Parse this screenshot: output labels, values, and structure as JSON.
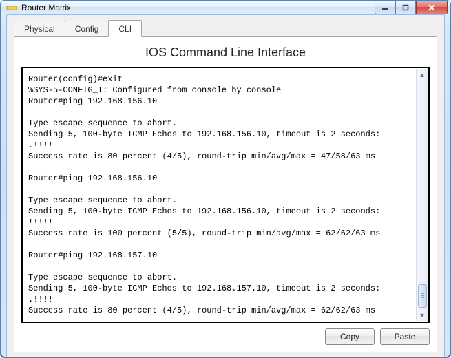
{
  "window": {
    "title": "Router Matrix"
  },
  "tabs": {
    "physical": "Physical",
    "config": "Config",
    "cli": "CLI"
  },
  "cli": {
    "heading": "IOS Command Line Interface",
    "output": "Router(config)#exit\n%SYS-5-CONFIG_I: Configured from console by console\nRouter#ping 192.168.156.10\n\nType escape sequence to abort.\nSending 5, 100-byte ICMP Echos to 192.168.156.10, timeout is 2 seconds:\n.!!!!\nSuccess rate is 80 percent (4/5), round-trip min/avg/max = 47/58/63 ms\n\nRouter#ping 192.168.156.10\n\nType escape sequence to abort.\nSending 5, 100-byte ICMP Echos to 192.168.156.10, timeout is 2 seconds:\n!!!!!\nSuccess rate is 100 percent (5/5), round-trip min/avg/max = 62/62/63 ms\n\nRouter#ping 192.168.157.10\n\nType escape sequence to abort.\nSending 5, 100-byte ICMP Echos to 192.168.157.10, timeout is 2 seconds:\n.!!!!\nSuccess rate is 80 percent (4/5), round-trip min/avg/max = 62/62/63 ms"
  },
  "buttons": {
    "copy": "Copy",
    "paste": "Paste"
  }
}
